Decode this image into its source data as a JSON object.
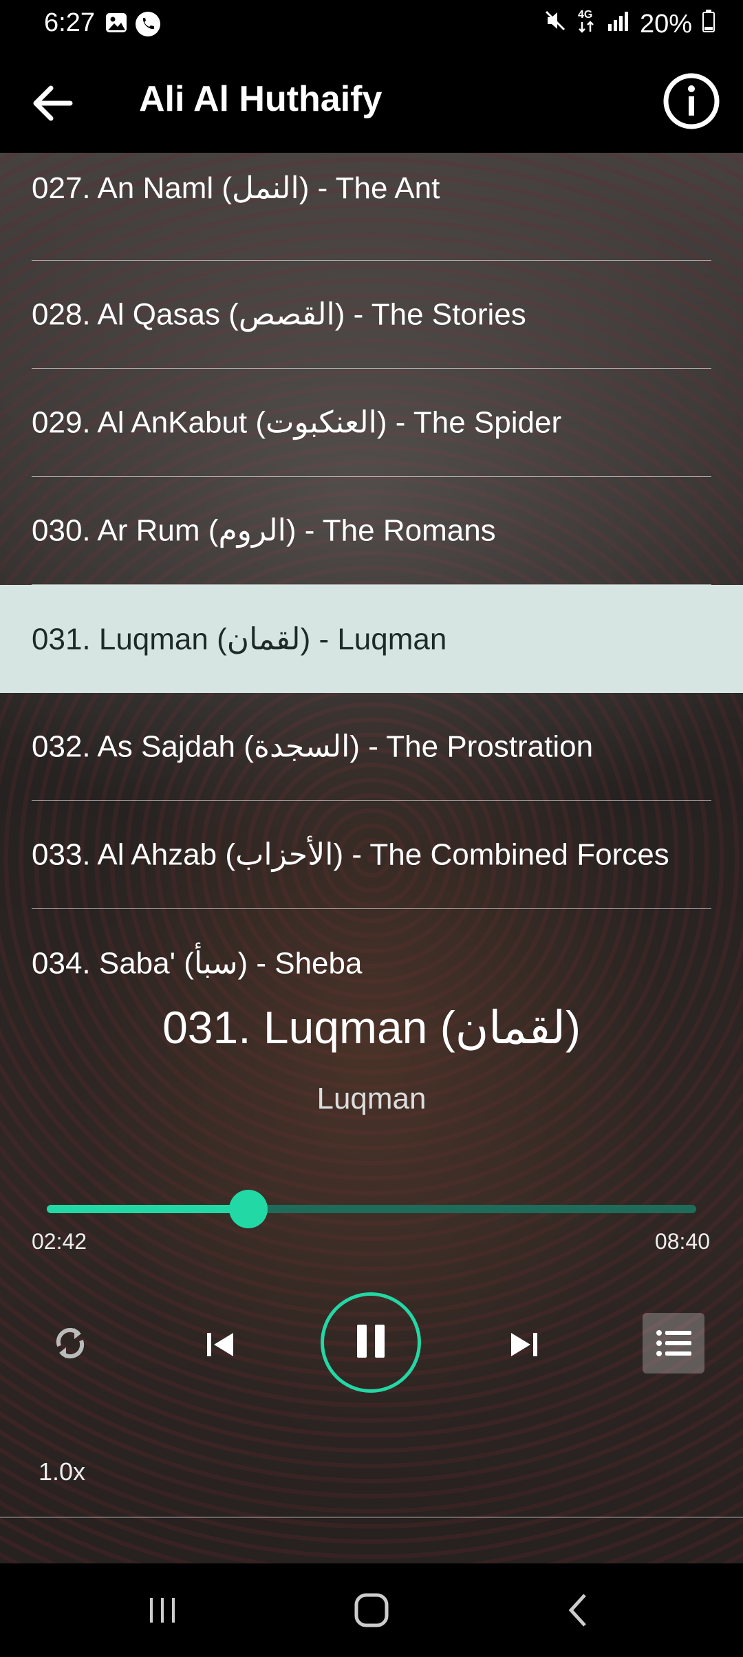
{
  "status_bar": {
    "time": "6:27",
    "left_icons": [
      "image-icon",
      "phone-icon"
    ],
    "right_icons": [
      "mute-icon",
      "4g-icon",
      "signal-icon",
      "battery-icon"
    ],
    "battery": "20%"
  },
  "app_bar": {
    "title": "Ali Al Huthaify",
    "back_icon": "arrow-left-icon",
    "info_icon": "info-icon"
  },
  "tracks": [
    {
      "label": "027. An Naml (النمل) - The Ant"
    },
    {
      "label": "028. Al Qasas (القصص) - The Stories"
    },
    {
      "label": "029. Al AnKabut (العنكبوت) - The Spider"
    },
    {
      "label": "030. Ar Rum (الروم) - The Romans"
    },
    {
      "label": "031. Luqman (لقمان) - Luqman",
      "selected": true
    },
    {
      "label": "032. As Sajdah (السجدة) - The Prostration"
    },
    {
      "label": "033. Al Ahzab (الأحزاب) - The Combined Forces"
    },
    {
      "label": "034. Saba' (سبأ) - Sheba"
    }
  ],
  "now_playing": {
    "title": "031. Luqman (لقمان)",
    "subtitle": "Luqman",
    "elapsed": "02:42",
    "duration": "08:40",
    "progress_fraction": 0.31,
    "accent_color": "#22d8a4",
    "track_color": "#1f6b59"
  },
  "controls": {
    "repeat_icon": "repeat-icon",
    "previous_icon": "skip-previous-icon",
    "play_pause_icon": "pause-icon",
    "next_icon": "skip-next-icon",
    "queue_icon": "queue-list-icon",
    "speed": "1.0x"
  },
  "nav_bar": {
    "recents_icon": "recents-icon",
    "home_icon": "home-icon",
    "back_icon": "nav-back-icon"
  }
}
